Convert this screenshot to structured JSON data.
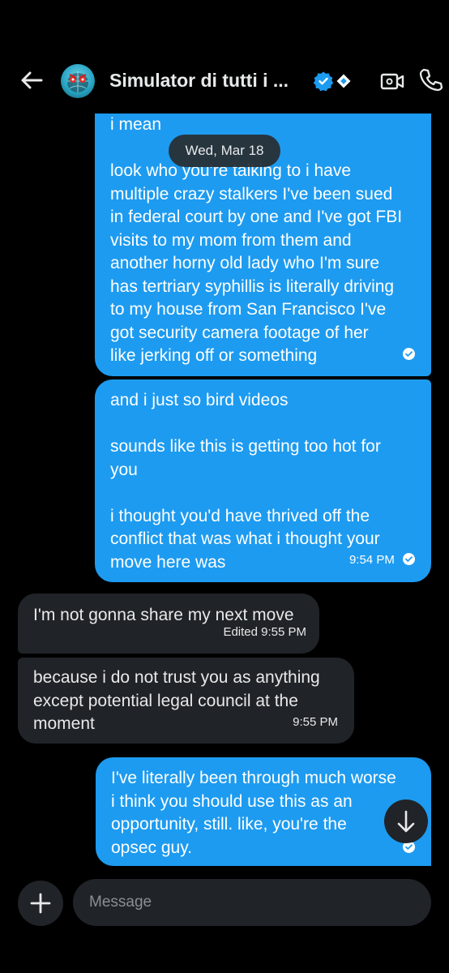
{
  "header": {
    "title": "Simulator di tutti i ...",
    "back_icon": "arrow-left-icon",
    "verified_icon": "verified-badge-icon",
    "affiliate_icon": "affiliate-badge-icon",
    "video_icon": "video-call-icon",
    "phone_icon": "phone-call-icon",
    "verified_color": "#1d9bf0"
  },
  "date_divider": "Wed, Mar 18",
  "messages": [
    {
      "direction": "outgoing",
      "lines": [
        "i mean",
        "",
        "look who you're talking to i have",
        "multiple crazy stalkers I've been sued",
        "in federal court by one and I've got FBI",
        "visits to my mom from them and",
        "another horny old lady who I'm sure",
        "has tertriary syphillis is literally driving",
        "to my house from San Francisco I've",
        "got security camera footage of her",
        "like jerking off or something"
      ],
      "time": "",
      "status": "sent"
    },
    {
      "direction": "outgoing",
      "lines": [
        "and i just so bird videos",
        "",
        "sounds like this is getting too hot for",
        "you",
        "",
        "i thought you'd have thrived off the",
        "conflict that was what i thought your",
        "move here was"
      ],
      "time": "9:54 PM",
      "status": "sent"
    },
    {
      "direction": "incoming",
      "lines": [
        "I'm not gonna share my next move"
      ],
      "time": "Edited 9:55 PM"
    },
    {
      "direction": "incoming",
      "lines": [
        "because i do not trust you as anything",
        "except potential legal council at the",
        "moment"
      ],
      "time": "9:55 PM"
    },
    {
      "direction": "outgoing",
      "lines": [
        "I've literally been through much worse",
        "i think you should use this as an",
        "opportunity, still. like, you're the",
        "opsec guy."
      ],
      "time": "",
      "status": "sent"
    }
  ],
  "composer": {
    "placeholder": "Message",
    "value": "",
    "add_icon": "plus-icon"
  },
  "scroll_icon": "arrow-down-icon",
  "colors": {
    "background": "#000000",
    "outgoing_bubble": "#1d9bf0",
    "incoming_bubble": "#202327",
    "text": "#e7e9ea"
  }
}
